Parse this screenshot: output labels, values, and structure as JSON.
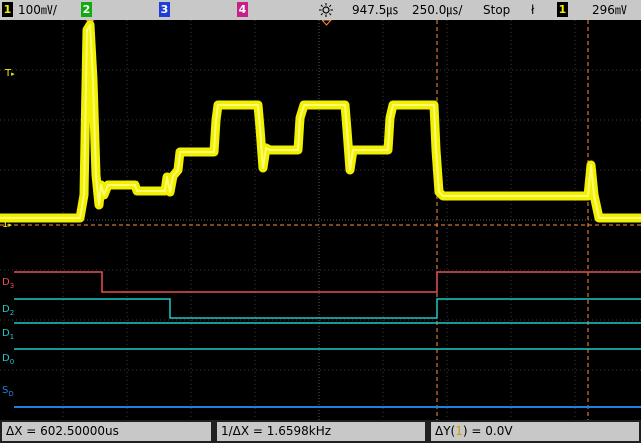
{
  "topbar": {
    "ch1_number": "1",
    "ch1_scale": "100㎷/",
    "ch2_number": "2",
    "ch3_number": "3",
    "ch4_number": "4",
    "trigger_icon": "sun-icon",
    "time_delay": "947.5㎲",
    "time_scale": "250.0㎲/",
    "run_state": "Stop",
    "trigger_slope_icon": "ł",
    "trigger_source": "1",
    "trigger_level": "296㎷"
  },
  "screen": {
    "trigger_level_marker": "T",
    "ground_marker": "1",
    "digital_labels": [
      {
        "main": "D",
        "sub": "3"
      },
      {
        "main": "D",
        "sub": "2"
      },
      {
        "main": "D",
        "sub": "1"
      },
      {
        "main": "D",
        "sub": "0"
      },
      {
        "main": "S",
        "sub": "D"
      }
    ]
  },
  "cursors": {
    "delta_x": "ΔX = 602.50000us",
    "inv_delta_x": "1/ΔX = 1.6598kHz",
    "delta_y_prefix": "ΔY(",
    "delta_y_channel": "1",
    "delta_y_suffix": ") = 0.0V"
  },
  "colors": {
    "ch1": "#f0f000",
    "d3": "#e85050",
    "d2": "#20c8c8",
    "d1": "#20c8c8",
    "d0": "#20c8c8",
    "serial": "#2080e0",
    "cursor": "#ff9040"
  }
}
